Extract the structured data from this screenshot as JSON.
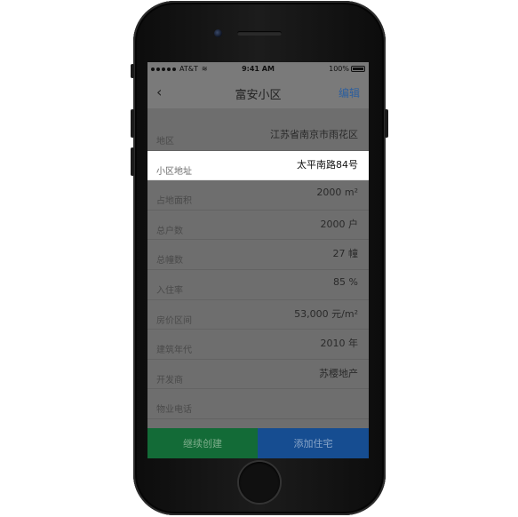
{
  "status_bar": {
    "carrier": "AT&T",
    "time": "9:41 AM",
    "battery": "100%"
  },
  "nav": {
    "back_icon": "chevron-left-icon",
    "back_glyph": "‹",
    "title": "富安小区",
    "edit_label": "编辑"
  },
  "details": [
    {
      "label": "地区",
      "value": "江苏省南京市雨花区"
    },
    {
      "label": "小区地址",
      "value": "太平南路84号"
    },
    {
      "label": "占地面积",
      "value": "2000 m²"
    },
    {
      "label": "总户数",
      "value": "2000 户"
    },
    {
      "label": "总幢数",
      "value": "27 幢"
    },
    {
      "label": "入住率",
      "value": "85 %"
    },
    {
      "label": "房价区间",
      "value": "53,000 元/m²"
    },
    {
      "label": "建筑年代",
      "value": "2010 年"
    },
    {
      "label": "开发商",
      "value": "苏樱地产"
    },
    {
      "label": "物业电话",
      "value": ""
    }
  ],
  "actions": {
    "continue_label": "继续创建",
    "add_label": "添加住宅"
  },
  "colors": {
    "continue_button": "#136b37",
    "add_button": "#164d91",
    "edit_link": "#2d5f9e"
  }
}
